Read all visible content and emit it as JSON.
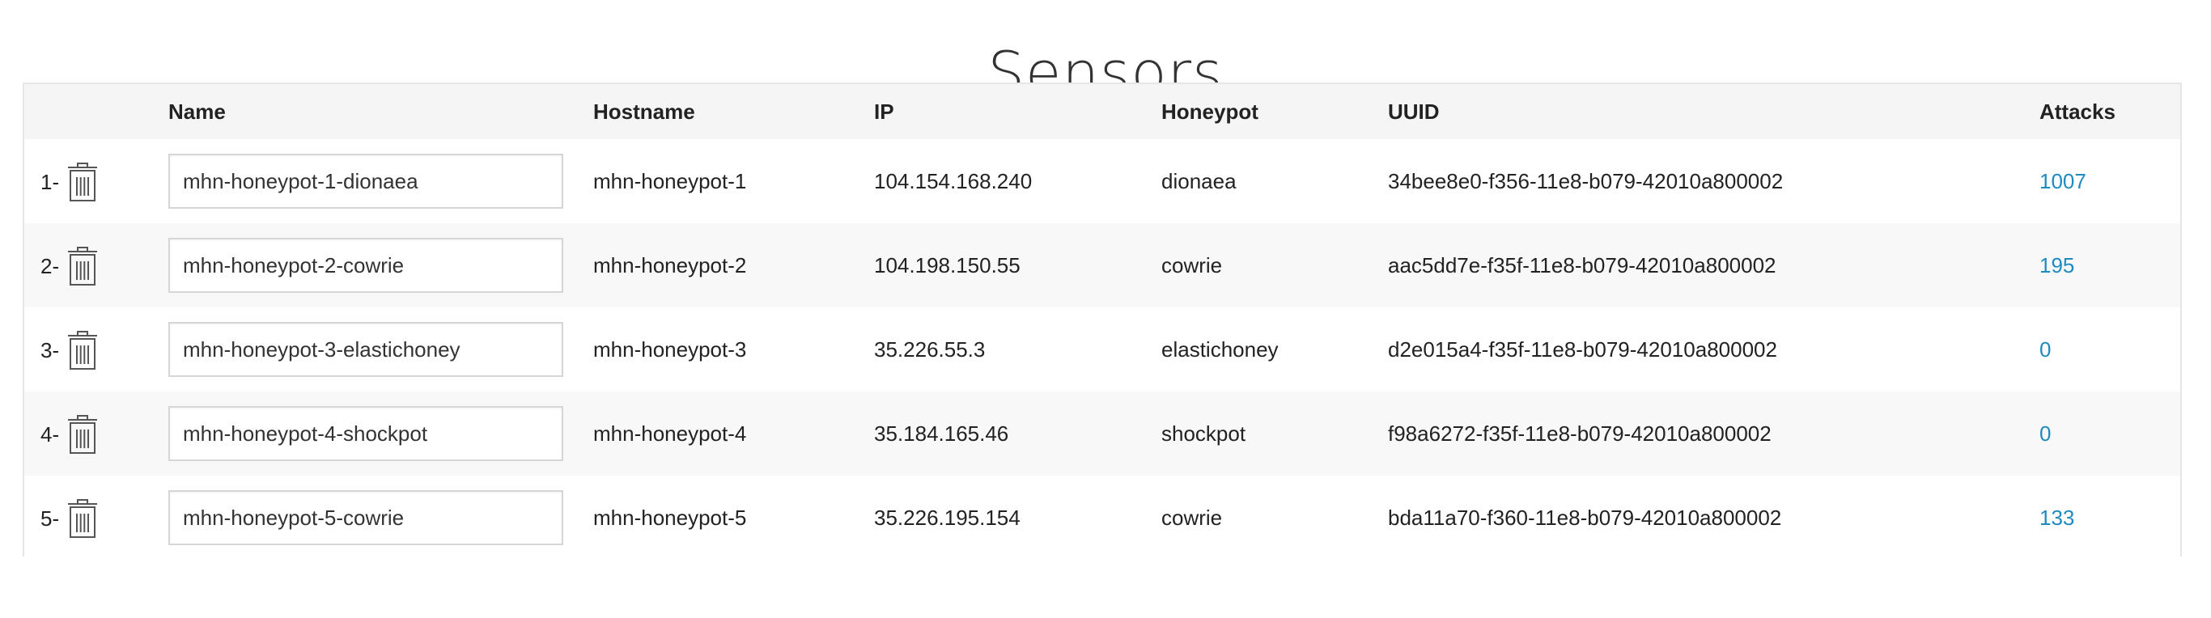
{
  "page": {
    "title": "Sensors"
  },
  "table": {
    "headers": {
      "number": "",
      "name": "Name",
      "hostname": "Hostname",
      "ip": "IP",
      "honeypot": "Honeypot",
      "uuid": "UUID",
      "attacks": "Attacks"
    },
    "rows": [
      {
        "number": "1-",
        "name": "mhn-honeypot-1-dionaea",
        "hostname": "mhn-honeypot-1",
        "ip": "104.154.168.240",
        "honeypot": "dionaea",
        "uuid": "34bee8e0-f356-11e8-b079-42010a800002",
        "attacks": "1007"
      },
      {
        "number": "2-",
        "name": "mhn-honeypot-2-cowrie",
        "hostname": "mhn-honeypot-2",
        "ip": "104.198.150.55",
        "honeypot": "cowrie",
        "uuid": "aac5dd7e-f35f-11e8-b079-42010a800002",
        "attacks": "195"
      },
      {
        "number": "3-",
        "name": "mhn-honeypot-3-elastichoney",
        "hostname": "mhn-honeypot-3",
        "ip": "35.226.55.3",
        "honeypot": "elastichoney",
        "uuid": "d2e015a4-f35f-11e8-b079-42010a800002",
        "attacks": "0"
      },
      {
        "number": "4-",
        "name": "mhn-honeypot-4-shockpot",
        "hostname": "mhn-honeypot-4",
        "ip": "35.184.165.46",
        "honeypot": "shockpot",
        "uuid": "f98a6272-f35f-11e8-b079-42010a800002",
        "attacks": "0"
      },
      {
        "number": "5-",
        "name": "mhn-honeypot-5-cowrie",
        "hostname": "mhn-honeypot-5",
        "ip": "35.226.195.154",
        "honeypot": "cowrie",
        "uuid": "bda11a70-f360-11e8-b079-42010a800002",
        "attacks": "133"
      }
    ]
  },
  "icons": {
    "delete": "trash-icon"
  },
  "colors": {
    "link": "#1f8ac0",
    "header_bg": "#f5f5f5",
    "row_alt_bg": "#f8f8f8"
  }
}
